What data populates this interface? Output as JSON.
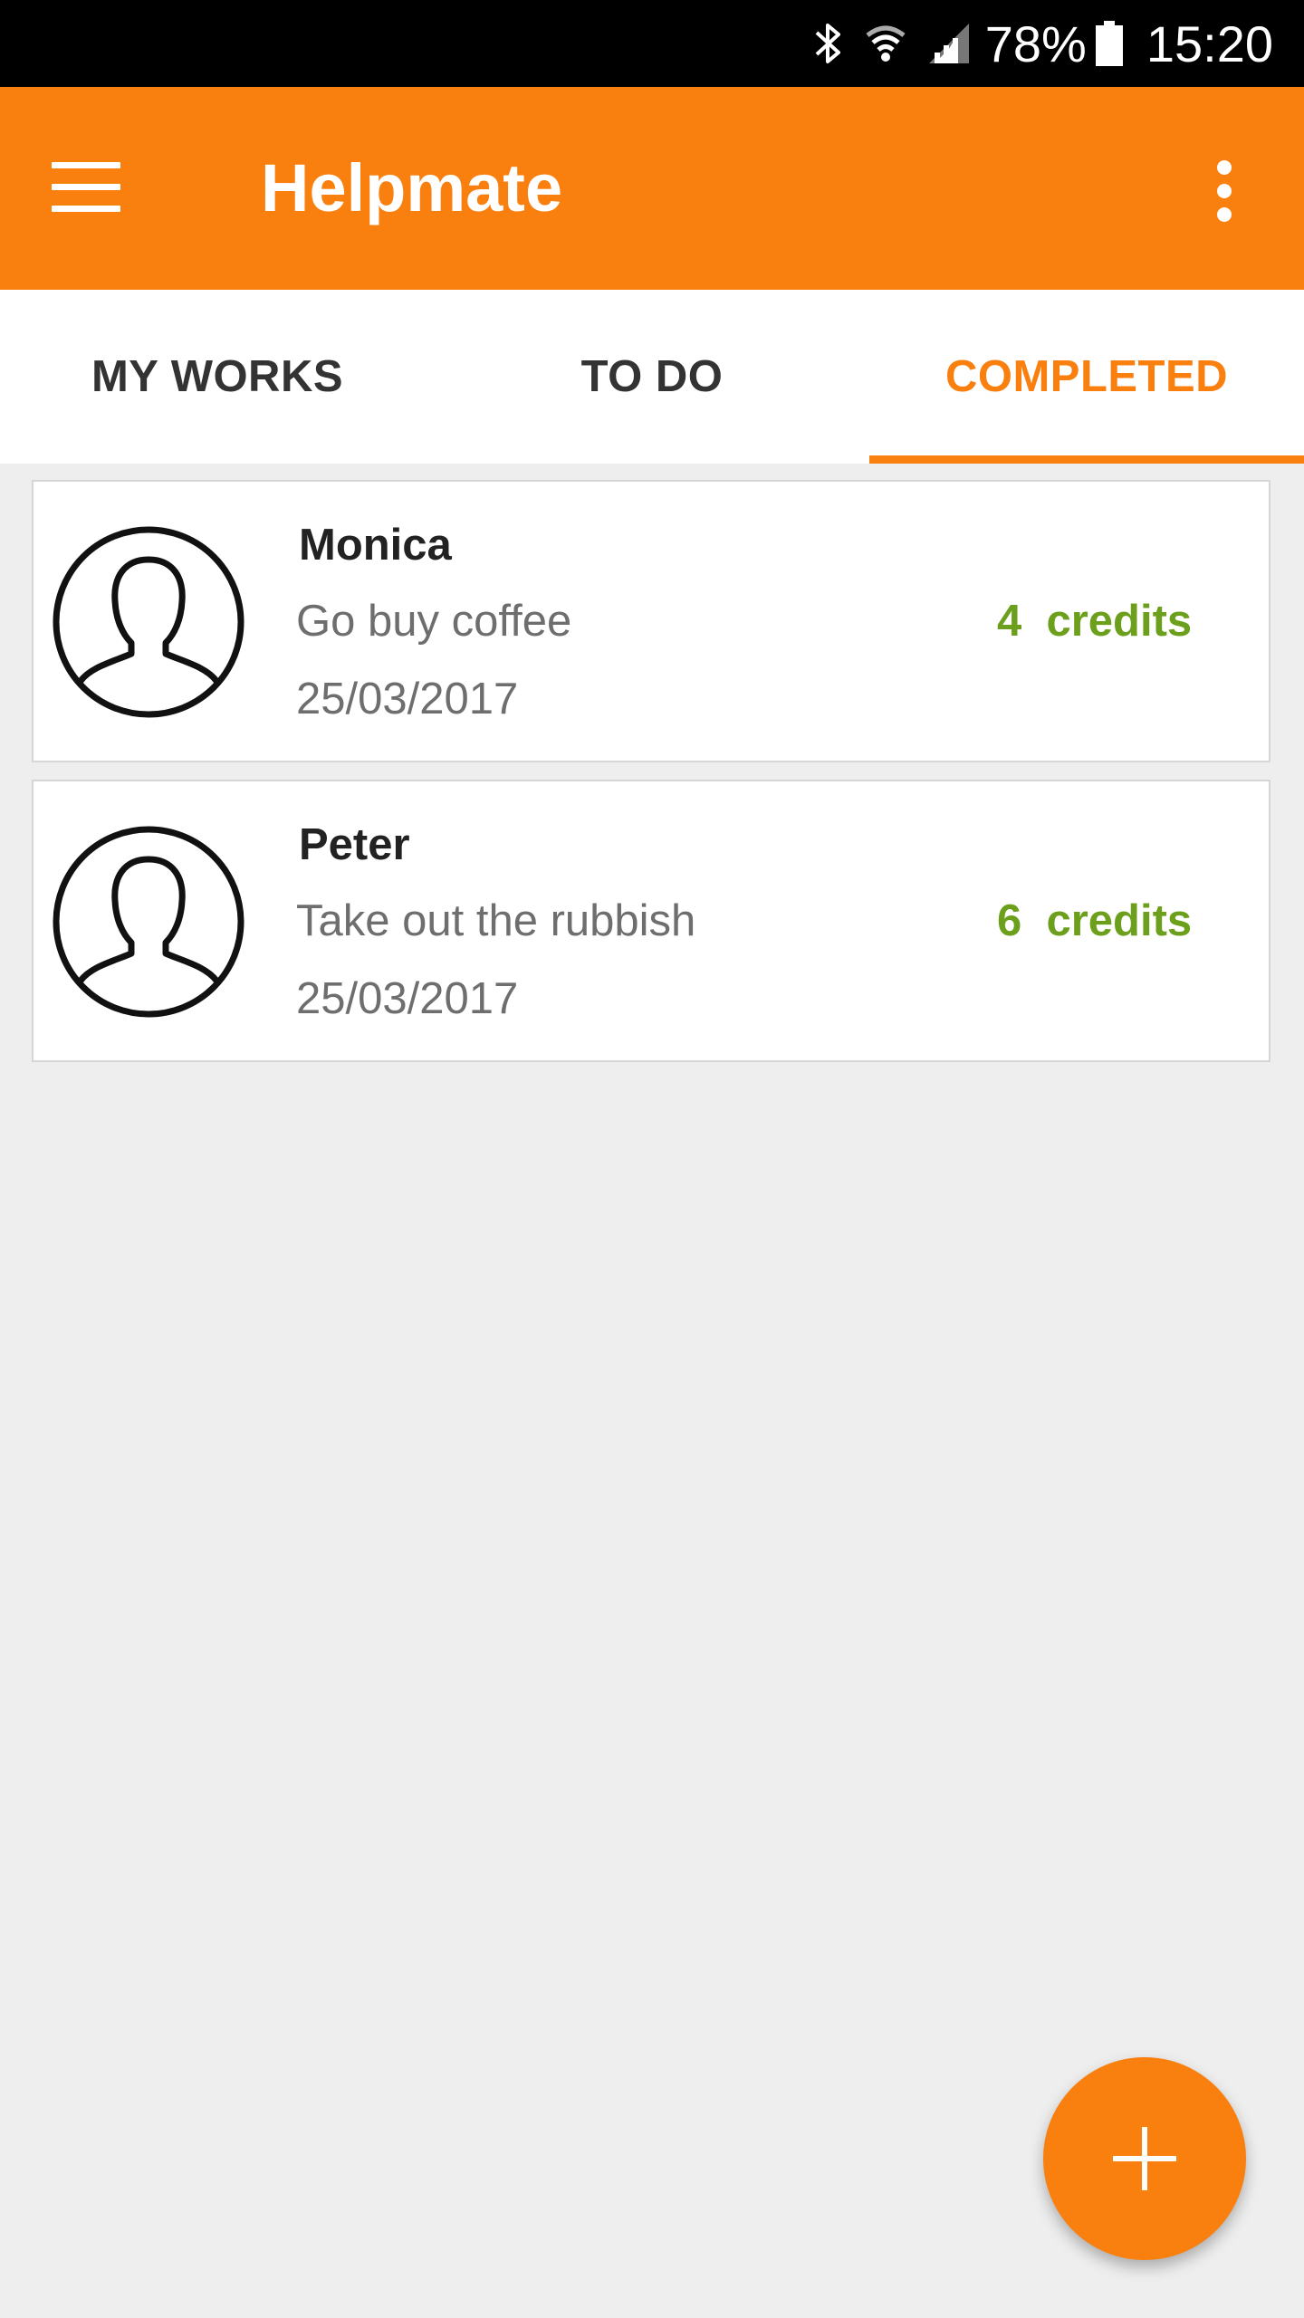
{
  "status_bar": {
    "battery": "78%",
    "time": "15:20",
    "icons": [
      "bluetooth-icon",
      "wifi-icon",
      "signal-icon",
      "battery-icon"
    ]
  },
  "app_bar": {
    "title": "Helpmate",
    "background_color": "#f97f0f",
    "icons": [
      "menu-icon",
      "overflow-icon"
    ]
  },
  "tabs": [
    {
      "label": "MY WORKS",
      "active": false
    },
    {
      "label": "TO DO",
      "active": false
    },
    {
      "label": "COMPLETED",
      "active": true
    }
  ],
  "accent_color": "#f97f0f",
  "credit_color": "#6ca01c",
  "completed": [
    {
      "name": "Monica",
      "task": "Go buy coffee",
      "date": "25/03/2017",
      "credits": "4  credits",
      "avatar": "user-silhouette-icon"
    },
    {
      "name": "Peter",
      "task": "Take out the rubbish",
      "date": "25/03/2017",
      "credits": "6  credits",
      "avatar": "user-silhouette-icon"
    }
  ],
  "fab": {
    "icon": "plus-icon"
  }
}
